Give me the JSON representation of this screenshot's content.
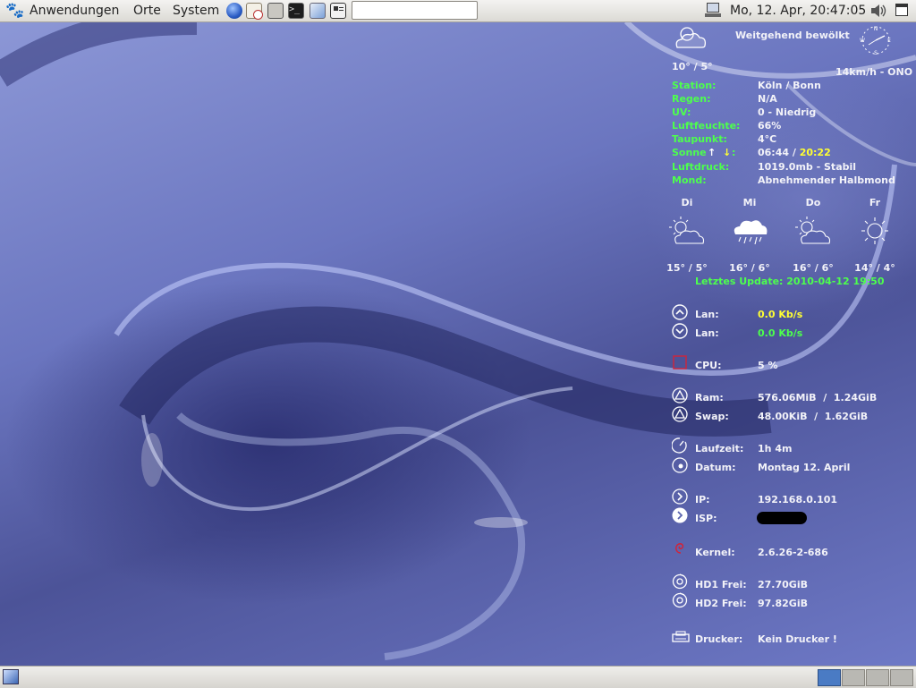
{
  "top_panel": {
    "menus": [
      "Anwendungen",
      "Orte",
      "System"
    ],
    "clock": "Mo, 12. Apr, 20:47:05"
  },
  "weather": {
    "condition": "Weitgehend bewölkt",
    "temp": "10° / 5°",
    "wind": "14km/h - ONO",
    "details": [
      {
        "label": "Station:",
        "value": "Köln / Bonn"
      },
      {
        "label": "Regen:",
        "value": "N/A"
      },
      {
        "label": "UV:",
        "value": "0 - Niedrig"
      },
      {
        "label": "Luftfeuchte:",
        "value": "66%"
      },
      {
        "label": "Taupunkt:",
        "value": "4°C"
      },
      {
        "label": "Sonne",
        "sep": ":",
        "sunrise": "06:44",
        "slash": " / ",
        "sunset": "20:22"
      },
      {
        "label": "Luftdruck:",
        "value": "1019.0mb - Stabil"
      },
      {
        "label": "Mond:",
        "value": "Abnehmender Halbmond"
      }
    ],
    "forecast": [
      {
        "day": "Di",
        "temp": "15° / 5°",
        "icon": "partly-cloudy-icon"
      },
      {
        "day": "Mi",
        "temp": "16° / 6°",
        "icon": "rain-cloud-icon"
      },
      {
        "day": "Do",
        "temp": "16° / 6°",
        "icon": "partly-cloudy-icon"
      },
      {
        "day": "Fr",
        "temp": "14° / 4°",
        "icon": "sun-icon"
      }
    ],
    "last_update": "Letztes Update: 2010-04-12 19:50"
  },
  "system": {
    "lan_up_label": "Lan:",
    "lan_up_value": "0.0 Kb/s",
    "lan_down_label": "Lan:",
    "lan_down_value": "0.0 Kb/s",
    "cpu_label": "CPU:",
    "cpu_value": "5 %",
    "ram_label": "Ram:",
    "ram_value": "576.06MiB  /  1.24GiB",
    "swap_label": "Swap:",
    "swap_value": "48.00KiB  /  1.62GiB",
    "uptime_label": "Laufzeit:",
    "uptime_value": "1h 4m",
    "date_label": "Datum:",
    "date_value": "Montag 12. April",
    "ip_label": "IP:",
    "ip_value": "192.168.0.101",
    "isp_label": "ISP:",
    "kernel_label": "Kernel:",
    "kernel_value": "2.6.26-2-686",
    "hd1_label": "HD1 Frei:",
    "hd1_value": "27.70GiB",
    "hd2_label": "HD2 Frei:",
    "hd2_value": "97.82GiB",
    "printer_label": "Drucker:",
    "printer_value": "Kein Drucker !"
  },
  "colors": {
    "label": "#4dff4d",
    "highlight": "#ffff33",
    "value": "#f2f2f8"
  }
}
